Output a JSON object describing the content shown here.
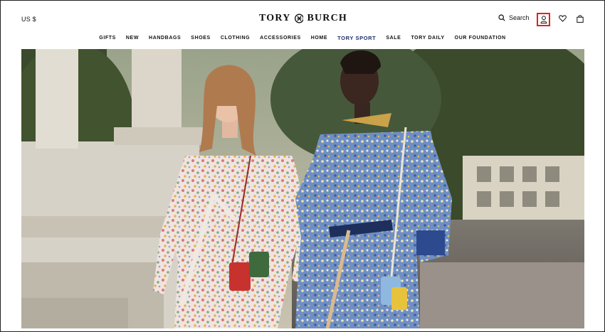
{
  "header": {
    "currency": "US $",
    "brand": "TORY BURCH",
    "search_label": "Search"
  },
  "icons": {
    "search": "search-icon",
    "account": "user-icon",
    "wishlist": "heart-icon",
    "bag": "shopping-bag-icon"
  },
  "nav": {
    "items": [
      "GIFTS",
      "NEW",
      "HANDBAGS",
      "SHOES",
      "CLOTHING",
      "ACCESSORIES",
      "HOME",
      "TORY SPORT",
      "SALE",
      "TORY DAILY",
      "OUR FOUNDATION"
    ]
  },
  "colors": {
    "highlight_box": "#e0231b",
    "tory_sport": "#1b2f6e"
  }
}
